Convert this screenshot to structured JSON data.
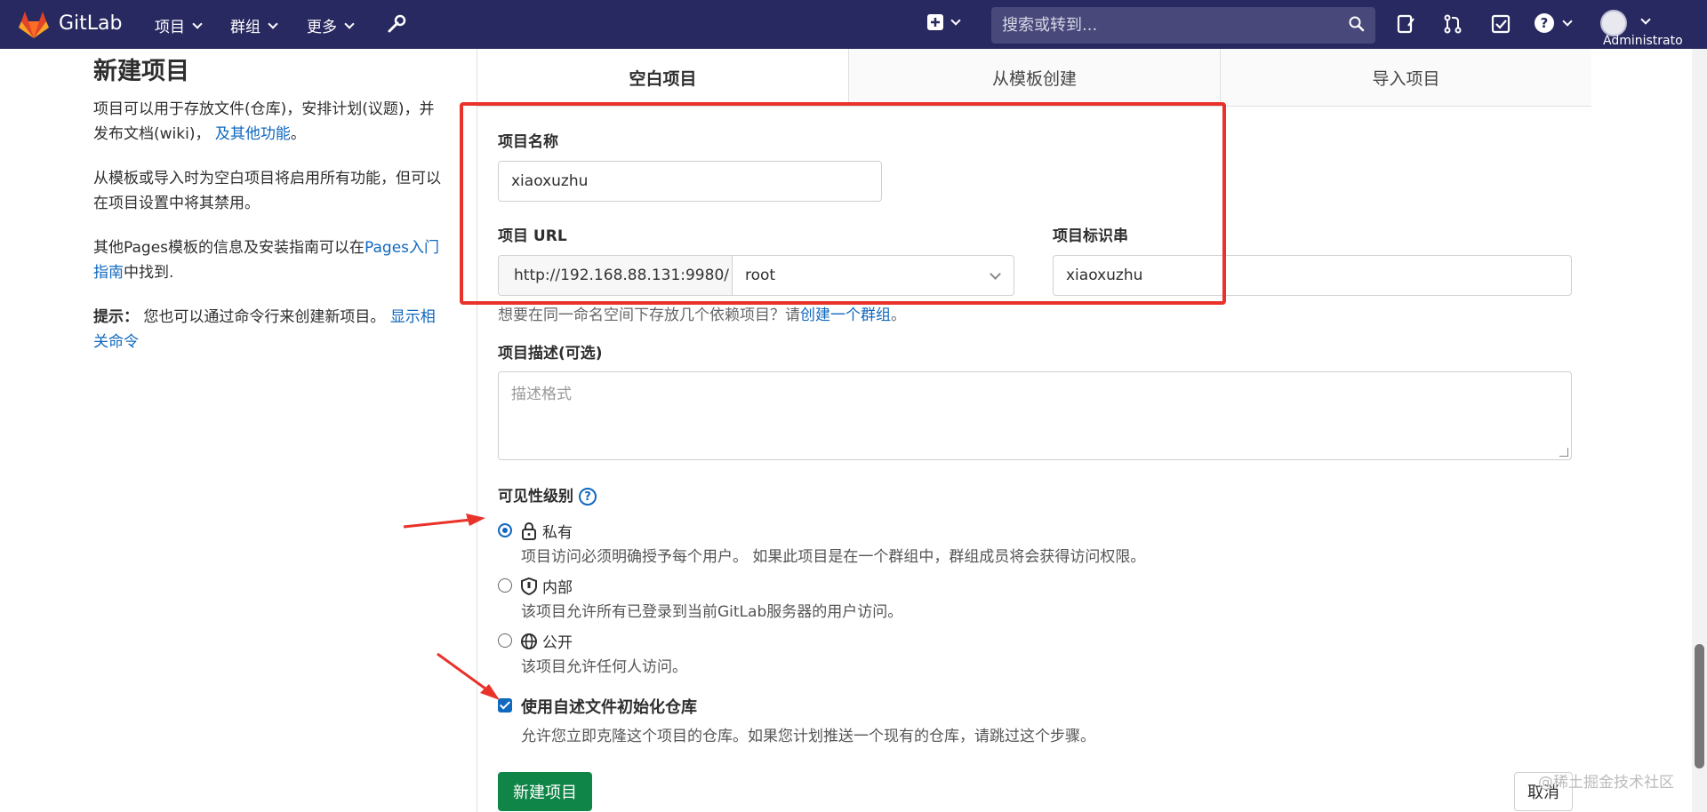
{
  "navbar": {
    "brand": "GitLab",
    "items": [
      {
        "label": "项目"
      },
      {
        "label": "群组"
      },
      {
        "label": "更多"
      }
    ],
    "search_placeholder": "搜索或转到...",
    "user_label": "Administrato"
  },
  "sidebar": {
    "title": "新建项目",
    "p1_text": "项目可以用于存放文件(仓库)，安排计划(议题)，并发布文档(wiki)，",
    "p1_link": "及其他功能",
    "p1_end": "。",
    "p2_text": "从模板或导入时为空白项目将启用所有功能，但可以在项目设置中将其禁用。",
    "p3_text": "其他Pages模板的信息及安装指南可以在",
    "p3_link": "Pages入门指南",
    "p3_end": "中找到.",
    "tip_label": "提示：",
    "tip_text": " 您也可以通过命令行来创建新项目。",
    "tip_link": "显示相关命令"
  },
  "tabs": [
    {
      "label": "空白项目",
      "active": true
    },
    {
      "label": "从模板创建",
      "active": false
    },
    {
      "label": "导入项目",
      "active": false
    }
  ],
  "form": {
    "name_label": "项目名称",
    "name_value": "xiaoxuzhu",
    "url_label": "项目 URL",
    "url_prefix": "http://192.168.88.131:9980/",
    "namespace_value": "root",
    "slug_label": "项目标识串",
    "slug_value": "xiaoxuzhu",
    "hint_text": "想要在同一命名空间下存放几个依赖项目？请",
    "hint_link": "创建一个群组",
    "hint_end": "。",
    "desc_label": "项目描述(可选)",
    "desc_placeholder": "描述格式",
    "visibility_label": "可见性级别",
    "visibility_help": "?",
    "visibility_options": [
      {
        "title": "私有",
        "desc": "项目访问必须明确授予每个用户。 如果此项目是在一个群组中，群组成员将会获得访问权限。",
        "checked": true,
        "icon": "lock-icon"
      },
      {
        "title": "内部",
        "desc": "该项目允许所有已登录到当前GitLab服务器的用户访问。",
        "checked": false,
        "icon": "shield-icon"
      },
      {
        "title": "公开",
        "desc": "该项目允许任何人访问。",
        "checked": false,
        "icon": "globe-icon"
      }
    ],
    "readme_label": "使用自述文件初始化仓库",
    "readme_desc": "允许您立即克隆这个项目的仓库。如果您计划推送一个现有的仓库，请跳过这个步骤。",
    "readme_checked": true,
    "create_button": "新建项目",
    "cancel_button": "取消"
  },
  "watermark": "@稀土掘金技术社区",
  "colors": {
    "navbar": "#292961",
    "primary_button": "#108548",
    "link": "#1068bf",
    "annotation": "#e8322a"
  }
}
